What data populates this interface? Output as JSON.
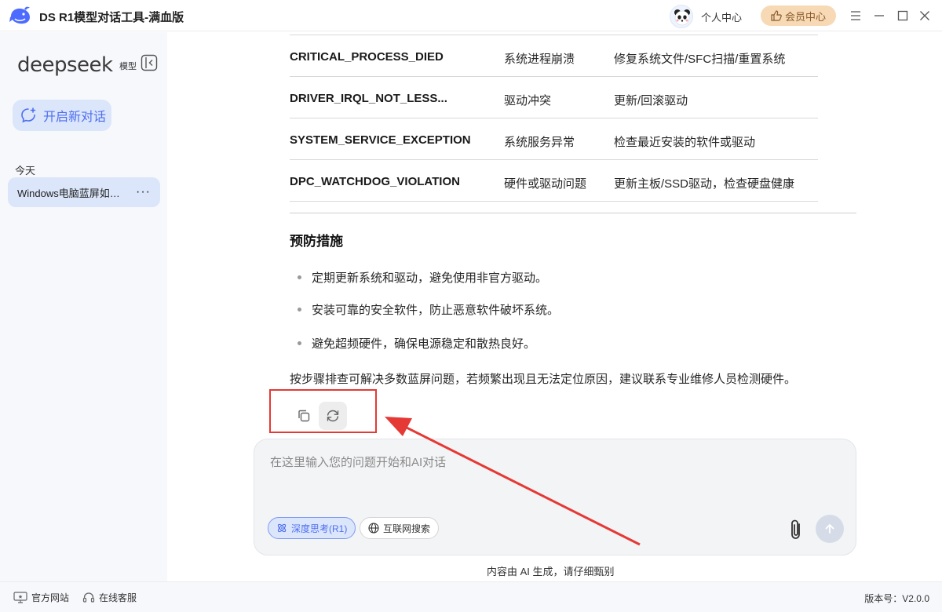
{
  "titlebar": {
    "app_title": "DS R1模型对话工具-满血版",
    "personal_center": "个人中心",
    "vip_center": "会员中心"
  },
  "sidebar": {
    "brand": "deepseek",
    "brand_sub": "模型",
    "new_chat": "开启新对话",
    "section_today": "今天",
    "chat_items": [
      {
        "label": "Windows电脑蓝屏如何解决",
        "more": "···"
      }
    ]
  },
  "content": {
    "table_rows": [
      {
        "code": "CRITICAL_PROCESS_DIED",
        "reason": "系统进程崩溃",
        "fix": "修复系统文件/SFC扫描/重置系统"
      },
      {
        "code": "DRIVER_IRQL_NOT_LESS...",
        "reason": "驱动冲突",
        "fix": "更新/回滚驱动"
      },
      {
        "code": "SYSTEM_SERVICE_EXCEPTION",
        "reason": "系统服务异常",
        "fix": "检查最近安装的软件或驱动"
      },
      {
        "code": "DPC_WATCHDOG_VIOLATION",
        "reason": "硬件或驱动问题",
        "fix": "更新主板/SSD驱动，检查硬盘健康"
      }
    ],
    "prevent_heading": "预防措施",
    "bullets": [
      "定期更新系统和驱动，避免使用非官方驱动。",
      "安装可靠的安全软件，防止恶意软件破坏系统。",
      "避免超频硬件，确保电源稳定和散热良好。"
    ],
    "summary": "按步骤排查可解决多数蓝屏问题，若频繁出现且无法定位原因，建议联系专业维修人员检测硬件。"
  },
  "composer": {
    "placeholder": "在这里输入您的问题开始和AI对话",
    "value": "",
    "deep_think": "深度思考(R1)",
    "web_search": "互联网搜索",
    "disclaimer": "内容由 AI 生成，请仔细甄别"
  },
  "footer": {
    "website": "官方网站",
    "support": "在线客服",
    "version": "版本号：V2.0.0"
  },
  "colors": {
    "accent": "#4f6ef0",
    "accent_bg": "#dbe6fb",
    "annotation_red": "#e53935",
    "vip_bg": "#f7d9b5"
  }
}
